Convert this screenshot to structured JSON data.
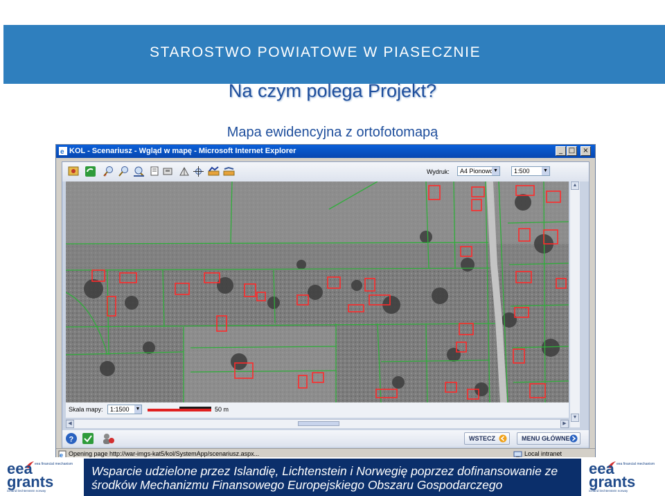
{
  "slide": {
    "org_title": "STAROSTWO POWIATOWE W PIASECZNIE",
    "title": "Na czym polega Projekt?",
    "subtitle": "Mapa ewidencyjna z ortofotomapą",
    "header_color": "#2f7fbe",
    "title_color": "#1e4e9c"
  },
  "browser": {
    "window_title": "KOL - Scenariusz - Wgląd w mapę - Microsoft Internet Explorer",
    "window_buttons": [
      "minimize",
      "maximize",
      "close"
    ],
    "toolbar": {
      "tools": [
        "refresh-icon",
        "recycle-icon",
        "zoom-in-icon",
        "zoom-out-icon",
        "zoom-extent-icon",
        "print-icon",
        "measure-icon",
        "info-icon",
        "pan-icon",
        "layers-icon",
        "line-icon",
        "legend-icon"
      ],
      "wydruk_label": "Wydruk:",
      "wydruk_value": "A4 Pionowo",
      "scale_value": "1:500"
    },
    "map": {
      "scale_label": "Skala mapy:",
      "scale_value": "1:1500",
      "scale_distance": "50 m"
    },
    "bottom_toolbar": {
      "back_label": "WSTECZ",
      "menu_label": "MENU GŁÓWNE"
    },
    "status": {
      "text": "Opening page http://war-imgs-kat5/kol/SystemApp/scenariusz.aspx...",
      "zone": "Local intranet"
    }
  },
  "footer": {
    "line1": "Wsparcie udzielone przez Islandię, Lichtenstein i Norwegię poprzez dofinansowanie ze",
    "line2": "środków Mechanizmu Finansowego Europejskiego Obszaru Gospodarczego",
    "logo_eea": "eea",
    "logo_grants": "grants",
    "logo_mechanism": "eea financial mechanism",
    "logo_sub": "iceland liechtenstein norway",
    "band_color": "#0b2f6b"
  }
}
